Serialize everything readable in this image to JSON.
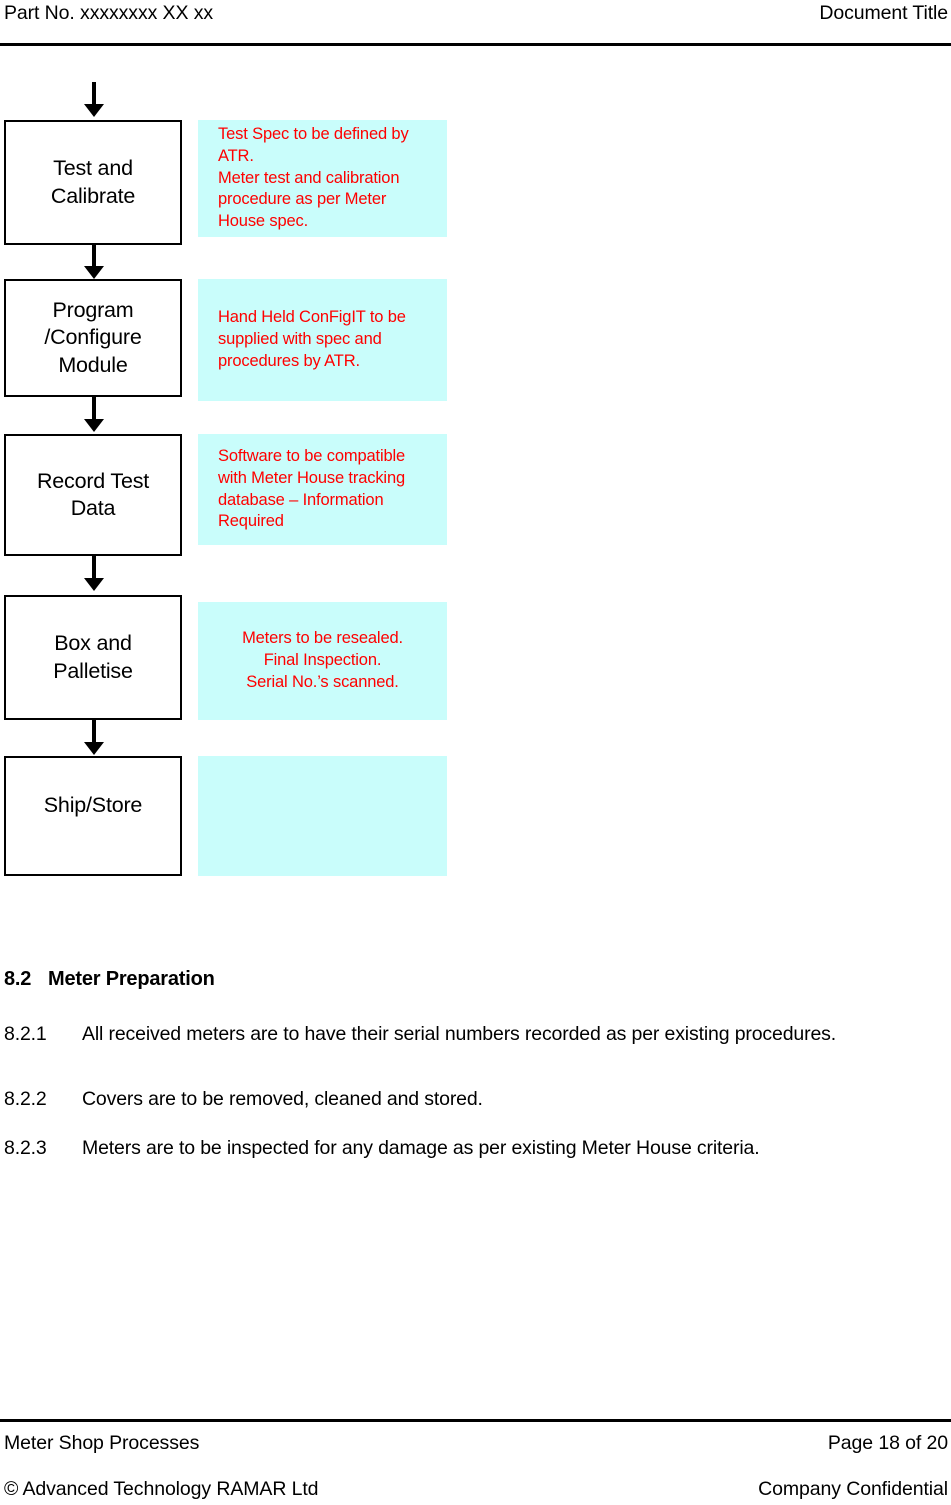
{
  "header": {
    "part_no": "Part No. xxxxxxxx XX xx",
    "document_title": "Document Title"
  },
  "flowchart": {
    "steps": [
      {
        "label_line1": "Test and",
        "label_line2": "Calibrate",
        "note_align": "left",
        "note_lines": [
          "Test Spec to be defined by ATR.",
          "Meter test and calibration procedure as per Meter House spec."
        ]
      },
      {
        "label_line1": "Program",
        "label_line2": "/Configure",
        "label_line3": "Module",
        "note_align": "left",
        "note_lines": [
          "Hand Held ConFigIT to be supplied with spec and procedures by ATR."
        ]
      },
      {
        "label_line1": "Record Test",
        "label_line2": "Data",
        "note_align": "left",
        "note_lines": [
          "Software to be compatible with Meter House tracking database – Information Required"
        ]
      },
      {
        "label_line1": "Box and",
        "label_line2": "Palletise",
        "note_align": "center",
        "note_lines": [
          "Meters to be resealed.",
          "Final Inspection.",
          "Serial No.’s scanned."
        ]
      },
      {
        "label_line1": "Ship/Store",
        "note_align": "left",
        "note_lines": []
      }
    ],
    "colors": {
      "note_background": "#c9fdfb",
      "note_text": "#ff0000",
      "box_border": "#000000"
    }
  },
  "section": {
    "number": "8.2",
    "title": "Meter Preparation",
    "clauses": [
      {
        "number": "8.2.1",
        "text": "All received meters are to have their serial numbers recorded as per existing procedures."
      },
      {
        "number": "8.2.2",
        "text": "Covers are to be removed, cleaned and stored."
      },
      {
        "number": "8.2.3",
        "text": "Meters are to be inspected for any damage as per existing Meter House criteria."
      }
    ]
  },
  "footer": {
    "document_name": "Meter Shop Processes",
    "page_label": "Page 18 of 20",
    "copyright": "© Advanced Technology RAMAR Ltd",
    "classification": "Company Confidential"
  }
}
